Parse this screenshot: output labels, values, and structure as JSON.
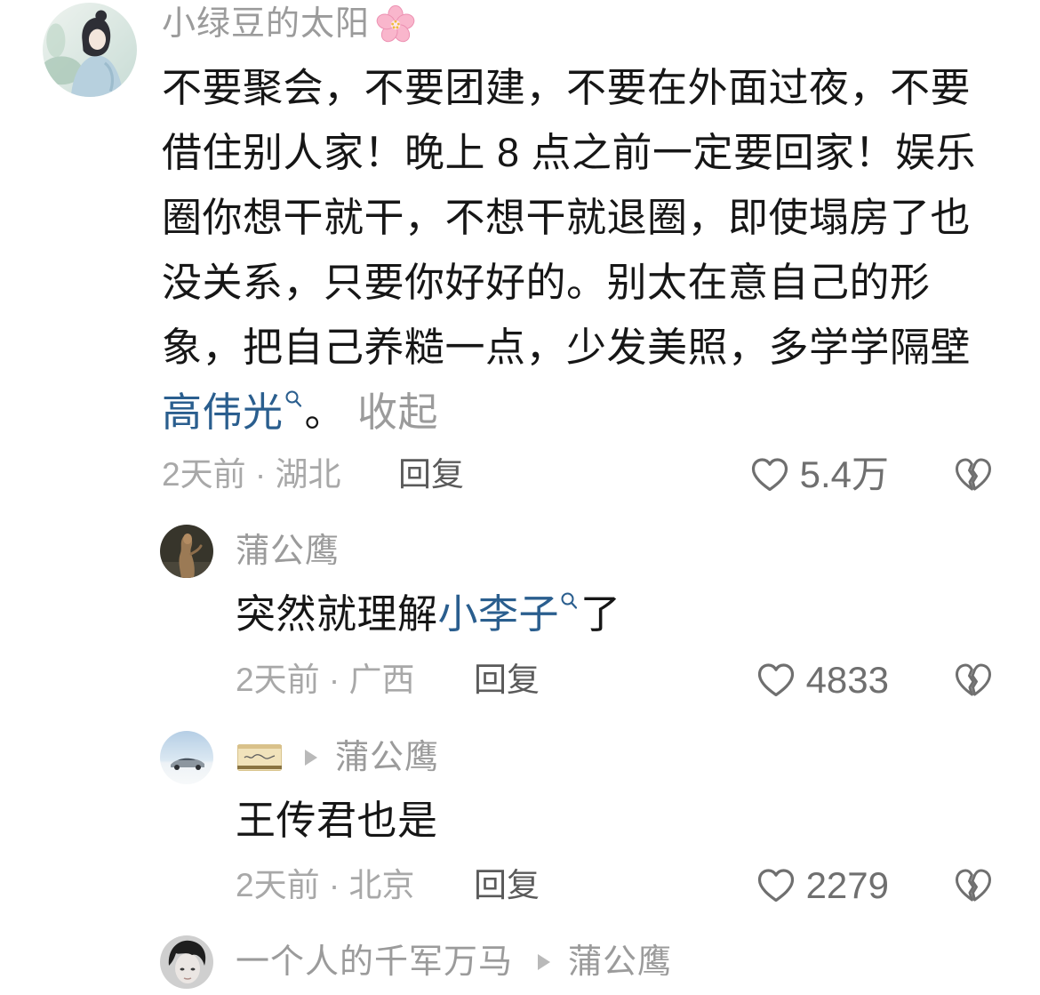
{
  "colors": {
    "background": "#ffffff",
    "text": "#161616",
    "username": "#9b9b9b",
    "link": "#2a5e8e",
    "meta": "#a8a8a8",
    "reply_label": "#5a5a5a",
    "count": "#6f6f6f",
    "icon": "#6f6f6f",
    "reply_arrow": "#b9b9b9"
  },
  "main_comment": {
    "username": "小绿豆的太阳",
    "username_emoji_icon": "cherry-blossom-icon",
    "body_lines": [
      "不要聚会，不要团建，不要在外面过夜，不要",
      "借住别人家！晚上 8 点之前一定要回家！娱乐",
      "圈你想干就干，不想干就退圈，即使塌房了也",
      "没关系，只要你好好的。别太在意自己的形",
      "象，把自己养糙一点，少发美照，多学学隔壁"
    ],
    "link_text": "高伟光",
    "link_icon": "search-icon",
    "after_link": "。",
    "collapse_label": "收起",
    "meta": "2天前 · 湖北",
    "reply_label": "回复",
    "like_icon": "heart-outline-icon",
    "like_count": "5.4万",
    "dislike_icon": "broken-heart-icon"
  },
  "replies": [
    {
      "username": "蒲公鹰",
      "body_before_link": "突然就理解",
      "link_text": "小李子",
      "link_icon": "search-icon",
      "body_after_link": "了",
      "meta": "2天前 · 广西",
      "reply_label": "回复",
      "like_count": "4833"
    },
    {
      "username_badge": "card-badge-image",
      "reply_arrow_icon": "play-triangle-icon",
      "reply_to": "蒲公鹰",
      "body": "王传君也是",
      "meta": "2天前 · 北京",
      "reply_label": "回复",
      "like_count": "2279"
    },
    {
      "username": "一个人的千军万马",
      "reply_arrow_icon": "play-triangle-icon",
      "reply_to": "蒲公鹰"
    }
  ]
}
